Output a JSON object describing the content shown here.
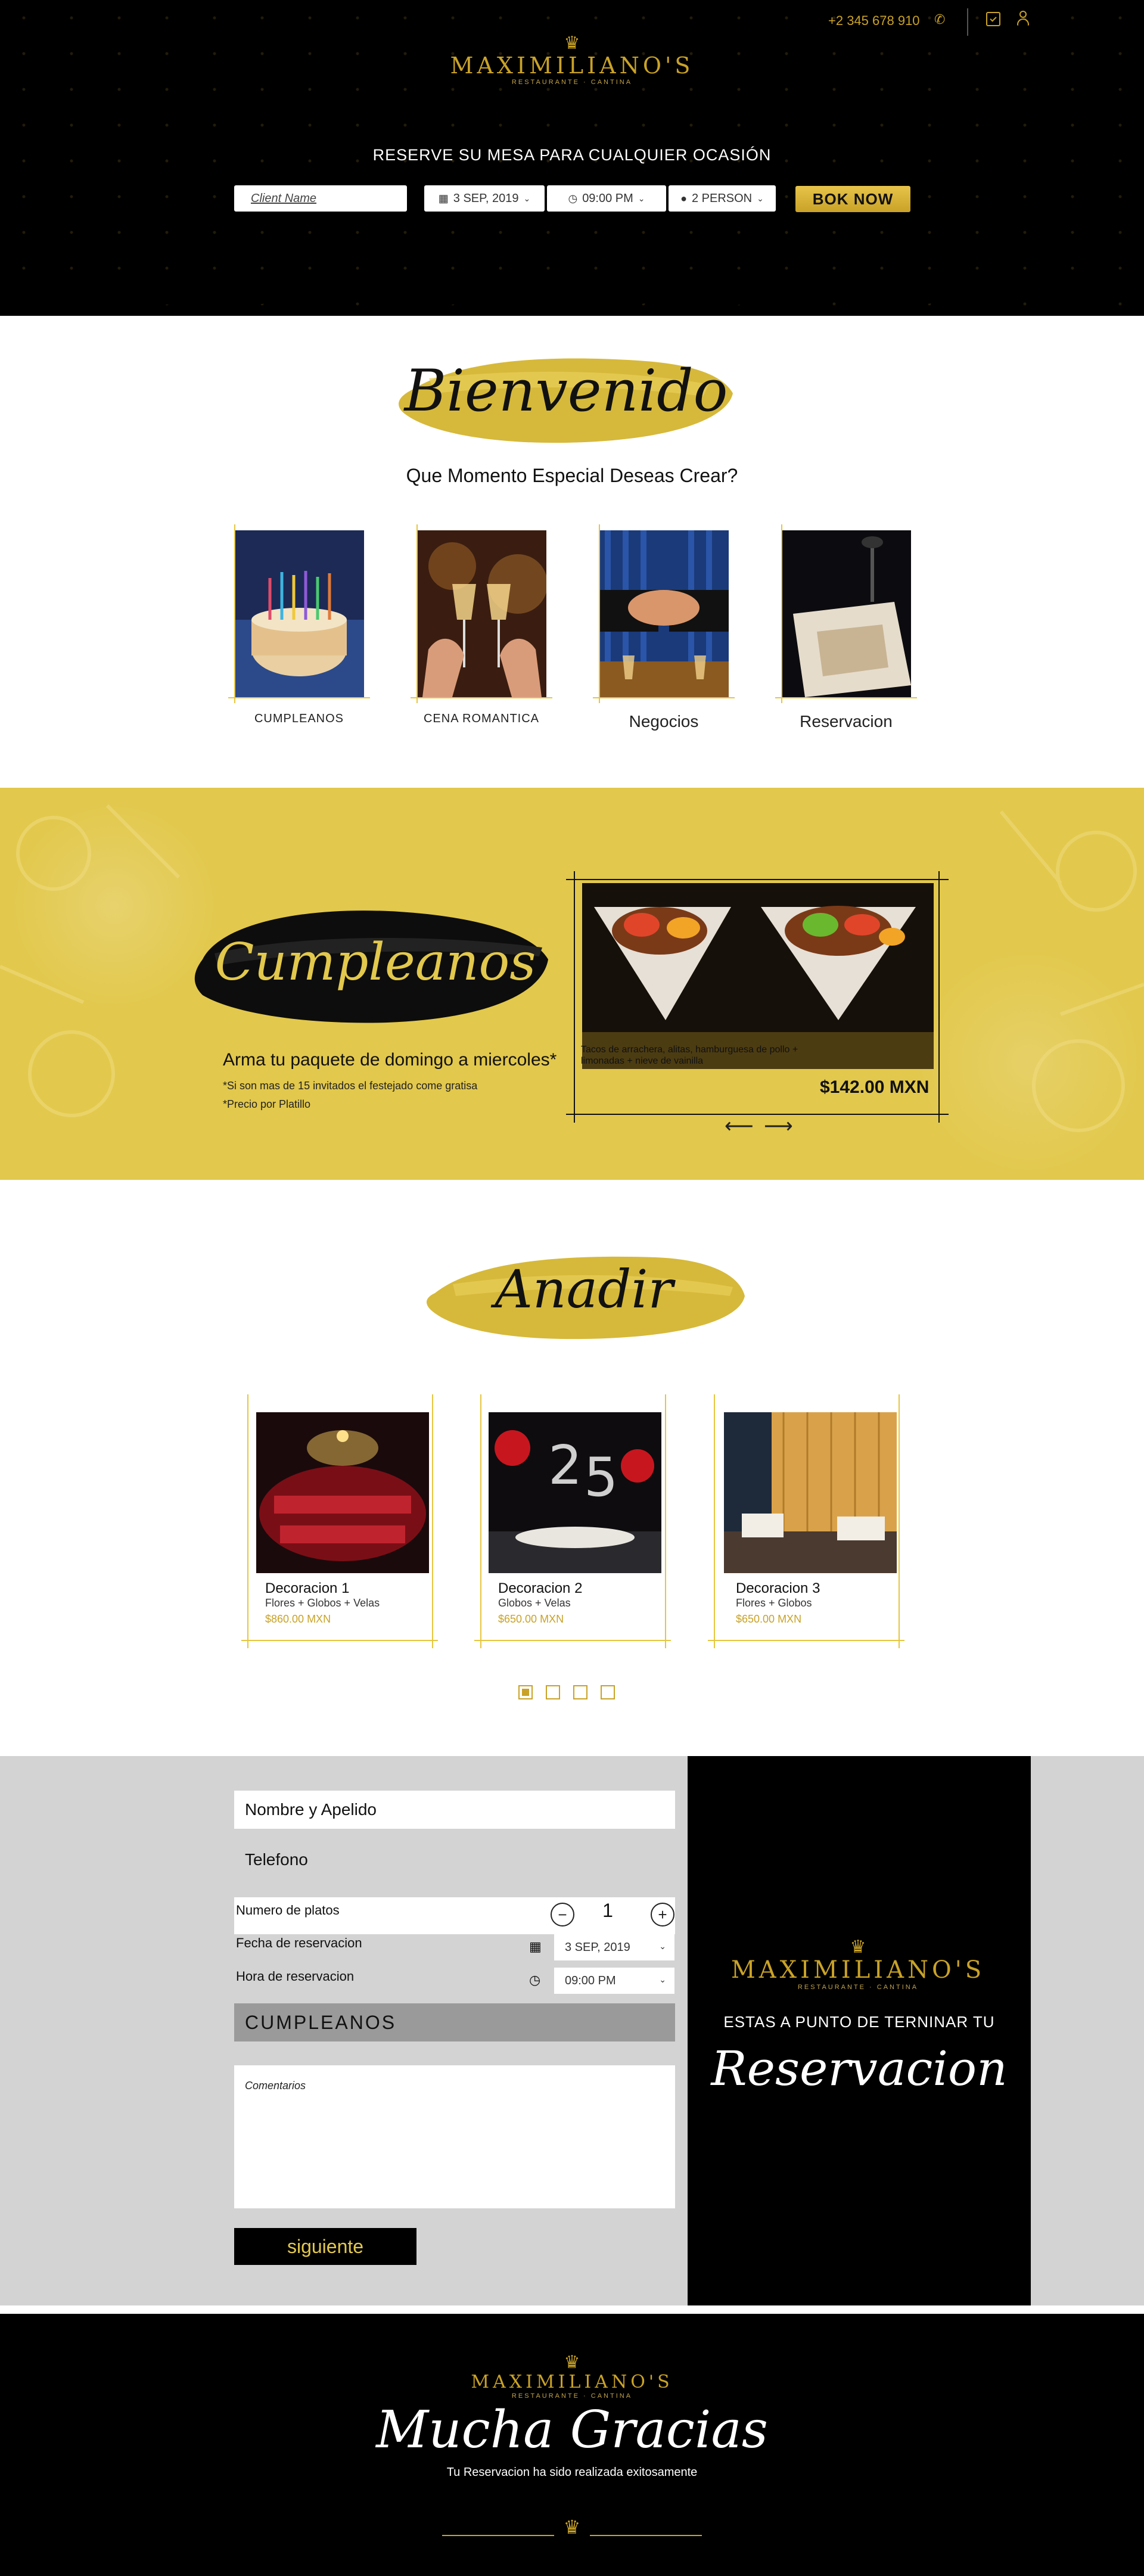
{
  "header": {
    "phone": "+2 345 678 910",
    "logo_name": "MAXIMILIANO'S",
    "logo_sub": "RESTAURANTE · CANTINA",
    "crown": "♛"
  },
  "booking": {
    "title": "RESERVE SU MESA PARA CUALQUIER OCASIÓN",
    "client_placeholder": "Client Name",
    "date": "3 SEP, 2019",
    "time": "09:00 PM",
    "persons": "2 PERSON",
    "book_label": "BOK NOW"
  },
  "welcome": {
    "title": "Bienvenido",
    "question": "Que Momento Especial Deseas Crear?",
    "occasions": [
      {
        "label": "CUMPLEANOS"
      },
      {
        "label": "CENA ROMANTICA"
      },
      {
        "label": "Negocios"
      },
      {
        "label": "Reservacion"
      }
    ]
  },
  "promo": {
    "title": "Cumpleanos",
    "line": "Arma tu paquete de domingo a miercoles*",
    "note1": "*Si son mas de 15 invitados el festejado come gratisa",
    "note2": "*Precio por Platillo",
    "slide_desc": "Tacos de arrachera, alitas, hamburguesa de pollo + limonadas + nieve de vainilla",
    "slide_price": "$142.00 MXN",
    "prev_arrow": "⟵",
    "next_arrow": "⟶"
  },
  "addons": {
    "title": "Anadir",
    "items": [
      {
        "title": "Decoracion 1",
        "sub": "Flores + Globos + Velas",
        "price": "$860.00 MXN"
      },
      {
        "title": "Decoracion 2",
        "sub": "Globos + Velas",
        "price": "$650.00 MXN"
      },
      {
        "title": "Decoracion 3",
        "sub": "Flores + Globos",
        "price": "$650.00 MXN"
      }
    ]
  },
  "form": {
    "name_label": "Nombre y Apelido",
    "phone_label": "Telefono",
    "plates_label": "Numero de platos",
    "plates_value": "1",
    "minus": "−",
    "plus": "+",
    "date_label": "Fecha de reservacion",
    "date_value": "3 SEP, 2019",
    "time_label": "Hora de reservacion",
    "time_value": "09:00 PM",
    "occasion": "CUMPLEANOS",
    "comments_placeholder": "Comentarios",
    "next_label": "siguiente"
  },
  "panel": {
    "tagline": "ESTAS A PUNTO DE TERNINAR TU",
    "script": "Reservacion"
  },
  "footer": {
    "script": "Mucha Gracias",
    "sub": "Tu Reservacion ha sido realizada exitosamente"
  },
  "colors": {
    "gold": "#c9a227",
    "gold_bright": "#e2c84c",
    "black": "#000000",
    "form_bg": "#d3d3d3"
  },
  "icons": {
    "phone": "phone-icon",
    "calendar": "calendar-check-icon",
    "user": "user-icon",
    "clock": "clock-icon",
    "person": "person-icon"
  }
}
